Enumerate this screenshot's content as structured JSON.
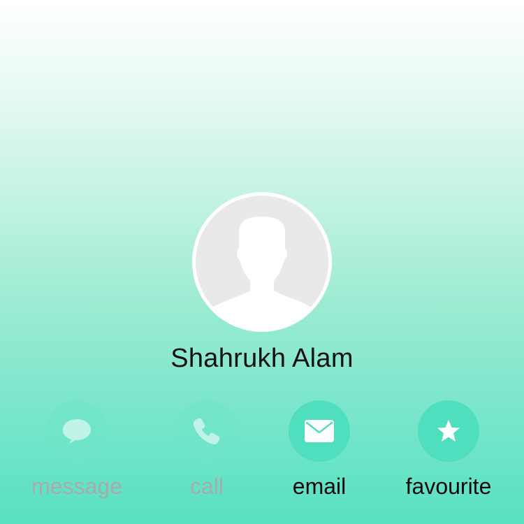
{
  "contact": {
    "name": "Shahrukh Alam",
    "avatar_icon": "person-silhouette-icon"
  },
  "actions": [
    {
      "id": "message",
      "label": "message",
      "icon": "message-bubble-icon",
      "enabled": false
    },
    {
      "id": "call",
      "label": "call",
      "icon": "phone-icon",
      "enabled": false
    },
    {
      "id": "email",
      "label": "email",
      "icon": "envelope-icon",
      "enabled": true
    },
    {
      "id": "favourite",
      "label": "favourite",
      "icon": "star-icon",
      "enabled": true
    }
  ],
  "colors": {
    "accent": "#4fdfbe",
    "gradient_top": "#ffffff",
    "gradient_bottom": "#58e1c1",
    "disabled_text": "#a9aaa9"
  }
}
